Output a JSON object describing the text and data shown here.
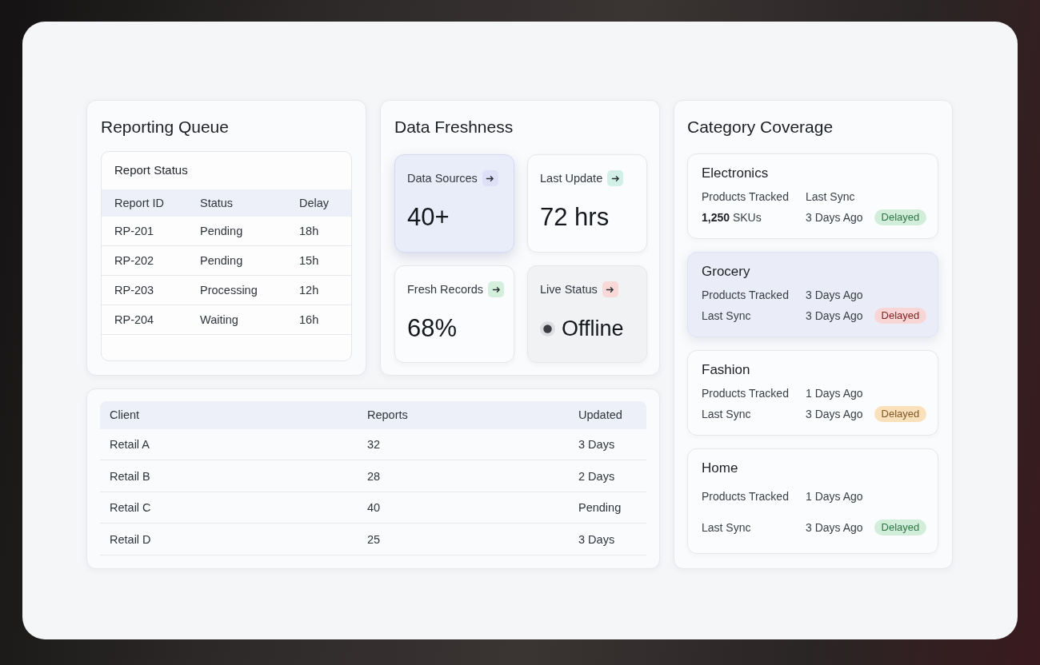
{
  "reporting_queue": {
    "title": "Reporting Queue",
    "table": {
      "title": "Report Status",
      "columns": [
        "Report ID",
        "Status",
        "Delay"
      ],
      "rows": [
        [
          "RP-201",
          "Pending",
          "18h"
        ],
        [
          "RP-202",
          "Pending",
          "15h"
        ],
        [
          "RP-203",
          "Processing",
          "12h"
        ],
        [
          "RP-204",
          "Waiting",
          "16h"
        ]
      ]
    }
  },
  "data_freshness": {
    "title": "Data Freshness",
    "tiles": [
      {
        "kind": "metric",
        "label": "Data Sources",
        "value": "40+",
        "selected": true,
        "color": "#dde0f7"
      },
      {
        "kind": "metric",
        "label": "Last Update",
        "value": "72 hrs",
        "selected": false,
        "color": "#d3f0e7"
      },
      {
        "kind": "metric",
        "label": "Fresh Records",
        "value": "68%",
        "selected": false,
        "color": "#d4f0dc"
      },
      {
        "kind": "status",
        "label": "Live Status",
        "value": "Offline",
        "selected": false,
        "color": "#f9d8d8"
      }
    ]
  },
  "category_coverage": {
    "title": "Category Coverage",
    "categories": [
      {
        "name": "Electronics",
        "selected": false,
        "rows": [
          {
            "cells": [
              "Products Tracked",
              "Last Sync"
            ]
          },
          {
            "cells": [
              "**1,250** SKUs",
              "3 Days Ago"
            ],
            "badge": {
              "label": "Delayed",
              "color": "#d2eedb"
            }
          }
        ]
      },
      {
        "name": "Grocery",
        "selected": true,
        "rows": [
          {
            "cells": [
              "Products Tracked",
              "3 Days Ago"
            ]
          },
          {
            "cells": [
              "Last Sync",
              "3 Days Ago"
            ],
            "badge": {
              "label": "Delayed",
              "color": "#f8d6d6"
            }
          }
        ]
      },
      {
        "name": "Fashion",
        "selected": false,
        "rows": [
          {
            "cells": [
              "Products Tracked",
              "1 Days Ago"
            ]
          },
          {
            "cells": [
              "Last Sync",
              "3 Days Ago"
            ],
            "badge": {
              "label": "Delayed",
              "color": "#fbe0bc"
            }
          }
        ]
      },
      {
        "name": "Home",
        "selected": false,
        "rows": [
          {
            "cells": [
              "Products Tracked",
              "1 Days Ago"
            ]
          },
          {
            "cells": [
              "Last Sync",
              "3 Days Ago"
            ],
            "badge": {
              "label": "Delayed",
              "color": "#d2eedb"
            }
          }
        ]
      }
    ]
  },
  "clients_table": {
    "columns": [
      "Client",
      "Reports",
      "Updated"
    ],
    "rows": [
      [
        "Retail A",
        "32",
        "3 Days"
      ],
      [
        "Retail B",
        "28",
        "2 Days"
      ],
      [
        "Retail C",
        "40",
        "Pending"
      ],
      [
        "Retail D",
        "25",
        "3 Days"
      ]
    ]
  }
}
